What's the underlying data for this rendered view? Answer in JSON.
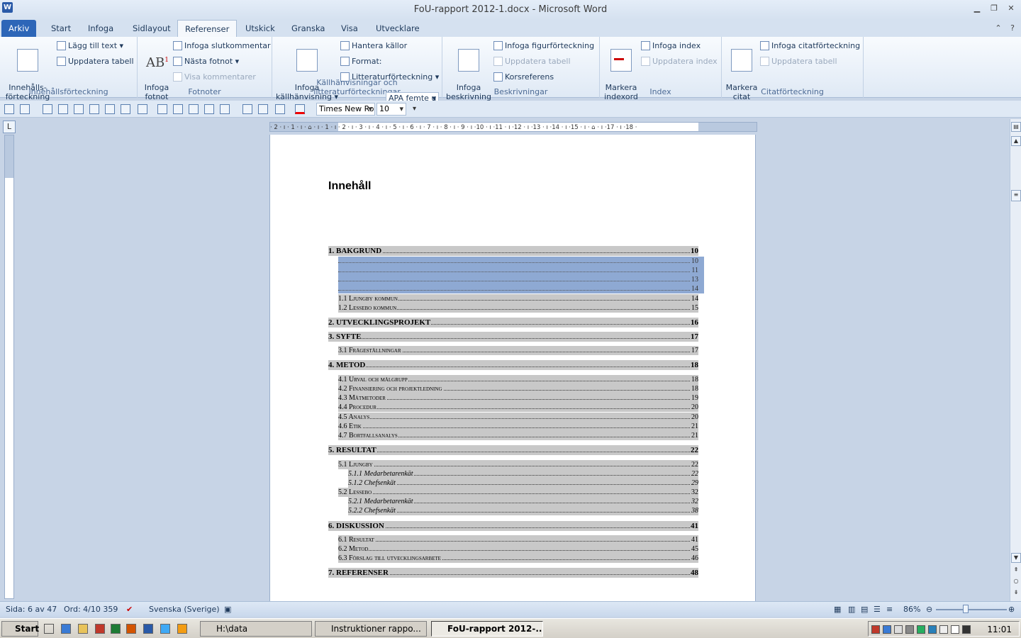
{
  "window": {
    "title": "FoU-rapport 2012-1.docx  -  Microsoft Word",
    "app_icon_letter": "W"
  },
  "tabs": [
    "Arkiv",
    "Start",
    "Infoga",
    "Sidlayout",
    "Referenser",
    "Utskick",
    "Granska",
    "Visa",
    "Utvecklare"
  ],
  "active_tab": "Referenser",
  "ribbon": {
    "toc_group": {
      "big_button": "Innehålls-\nförteckning",
      "add_text": "Lägg till text",
      "update_table": "Uppdatera tabell",
      "label": "Innehållsförteckning"
    },
    "footnotes_group": {
      "insert_footnote": "Infoga\nfotnot",
      "ab_glyph": "AB",
      "insert_endnote": "Infoga slutkommentar",
      "next_footnote": "Nästa fotnot",
      "show_notes": "Visa kommentarer",
      "label": "Fotnoter"
    },
    "citations_group": {
      "insert_citation": "Infoga\nkällhänvisning",
      "manage_sources": "Hantera källor",
      "format_label": "Format:",
      "format_value": "APA femte u",
      "bibliography": "Litteraturförteckning",
      "label": "Källhänvisningar och litteraturförteckningar"
    },
    "captions_group": {
      "insert_caption": "Infoga\nbeskrivning",
      "insert_table_of_figures": "Infoga figurförteckning",
      "update_table": "Uppdatera tabell",
      "cross_reference": "Korsreferens",
      "label": "Beskrivningar"
    },
    "index_group": {
      "mark_entry": "Markera\nindexord",
      "insert_index": "Infoga index",
      "update_index": "Uppdatera index",
      "label": "Index"
    },
    "authorities_group": {
      "mark_citation": "Markera\ncitat",
      "insert_toa": "Infoga citatförteckning",
      "update_table": "Uppdatera tabell",
      "label": "Citatförteckning"
    }
  },
  "qat": {
    "font_name": "Times New Ro",
    "font_size": "10"
  },
  "ruler": {
    "numbers": "· 2 · ı · 1 · ı · ⌂ · ı · 1 · ı · 2 · ı · 3 · ı · 4 · ı · 5 · ı · 6 · ı · 7 · ı · 8 · ı · 9 · ı ·10 · ı ·11 · ı ·12 · ı ·13 · ı ·14 · ı ·15 · ı · ⌂ · ı ·17 · ı ·18 ·",
    "corner": "L"
  },
  "document": {
    "heading": "Innehåll",
    "selected_pages": [
      "10",
      "11",
      "13",
      "14"
    ],
    "toc": [
      {
        "level": 1,
        "text": "1. BAKGRUND",
        "page": "10"
      },
      {
        "level": 2,
        "text": "1.1 Ljungby kommun",
        "page": "14"
      },
      {
        "level": 2,
        "text": "1.2 Lessebo kommun",
        "page": "15"
      },
      {
        "level": 1,
        "text": "2. UTVECKLINGSPROJEKT",
        "page": "16"
      },
      {
        "level": 1,
        "text": "3. SYFTE",
        "page": "17"
      },
      {
        "level": 2,
        "text": "3.1 Frågeställningar",
        "page": "17"
      },
      {
        "level": 1,
        "text": "4. METOD",
        "page": "18"
      },
      {
        "level": 2,
        "text": "4.1 Urval och målgrupp",
        "page": "18"
      },
      {
        "level": 2,
        "text": "4.2 Finansiering och projektledning",
        "page": "18"
      },
      {
        "level": 2,
        "text": "4.3 Mätmetoder",
        "page": "19"
      },
      {
        "level": 2,
        "text": "4.4 Procedur",
        "page": "20"
      },
      {
        "level": 2,
        "text": "4.5 Analys",
        "page": "20"
      },
      {
        "level": 2,
        "text": "4.6 Etik",
        "page": "21"
      },
      {
        "level": 2,
        "text": "4.7 Bortfallsanalys",
        "page": "21"
      },
      {
        "level": 1,
        "text": "5. RESULTAT",
        "page": "22"
      },
      {
        "level": 2,
        "text": "5.1 Ljungby",
        "page": "22"
      },
      {
        "level": 3,
        "text": "5.1.1 Medarbetarenkät",
        "page": "22"
      },
      {
        "level": 3,
        "text": "5.1.2  Chefsenkät",
        "page": "29"
      },
      {
        "level": 2,
        "text": "5.2 Lessebo",
        "page": "32"
      },
      {
        "level": 3,
        "text": "5.2.1 Medarbetarenkät",
        "page": "32"
      },
      {
        "level": 3,
        "text": "5.2.2 Chefsenkät",
        "page": "38"
      },
      {
        "level": 1,
        "text": "6. DISKUSSION",
        "page": "41"
      },
      {
        "level": 2,
        "text": "6.1 Resultat",
        "page": "41"
      },
      {
        "level": 2,
        "text": "6.2 Metod",
        "page": "45"
      },
      {
        "level": 2,
        "text": "6.3 Förslag till utvecklingsarbete",
        "page": "46"
      },
      {
        "level": 1,
        "text": "7. REFERENSER",
        "page": "48"
      }
    ]
  },
  "statusbar": {
    "page": "Sida: 6 av 47",
    "words": "Ord: 4/10 359",
    "language": "Svenska (Sverige)",
    "zoom": "86%",
    "zoom_level_percent": 86
  },
  "taskbar": {
    "start": "Start",
    "items": [
      "H:\\data",
      "Instruktioner rappo...",
      "FoU-rapport 2012-..."
    ],
    "clock": "11:01"
  },
  "colors": {
    "ribbon_bg": "#dfe9f5",
    "file_tab": "#2d66b8",
    "selection": "#8ea9d3",
    "toc_field_shading": "#c8c8c8"
  }
}
